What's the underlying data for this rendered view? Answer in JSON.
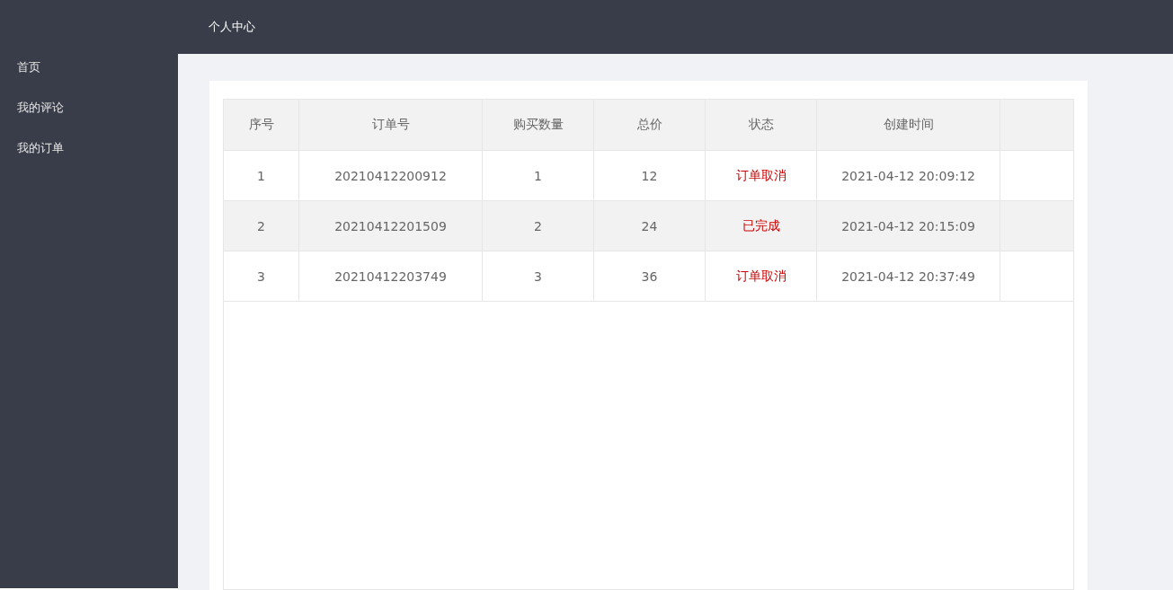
{
  "header": {
    "title": "个人中心"
  },
  "sidebar": {
    "items": [
      {
        "label": "首页",
        "selected": false
      },
      {
        "label": "我的评论",
        "selected": false
      },
      {
        "label": "我的订单",
        "selected": false
      }
    ]
  },
  "table": {
    "columns": [
      "序号",
      "订单号",
      "购买数量",
      "总价",
      "状态",
      "创建时间"
    ],
    "rows": [
      {
        "cells": [
          "1",
          "20210412200912",
          "1",
          "12",
          "订单取消",
          "2021-04-12 20:09:12"
        ],
        "highlighted": false
      },
      {
        "cells": [
          "2",
          "20210412201509",
          "2",
          "24",
          "已完成",
          "2021-04-12 20:15:09"
        ],
        "highlighted": true
      },
      {
        "cells": [
          "3",
          "20210412203749",
          "3",
          "36",
          "订单取消",
          "2021-04-12 20:37:49"
        ],
        "highlighted": false
      }
    ]
  }
}
